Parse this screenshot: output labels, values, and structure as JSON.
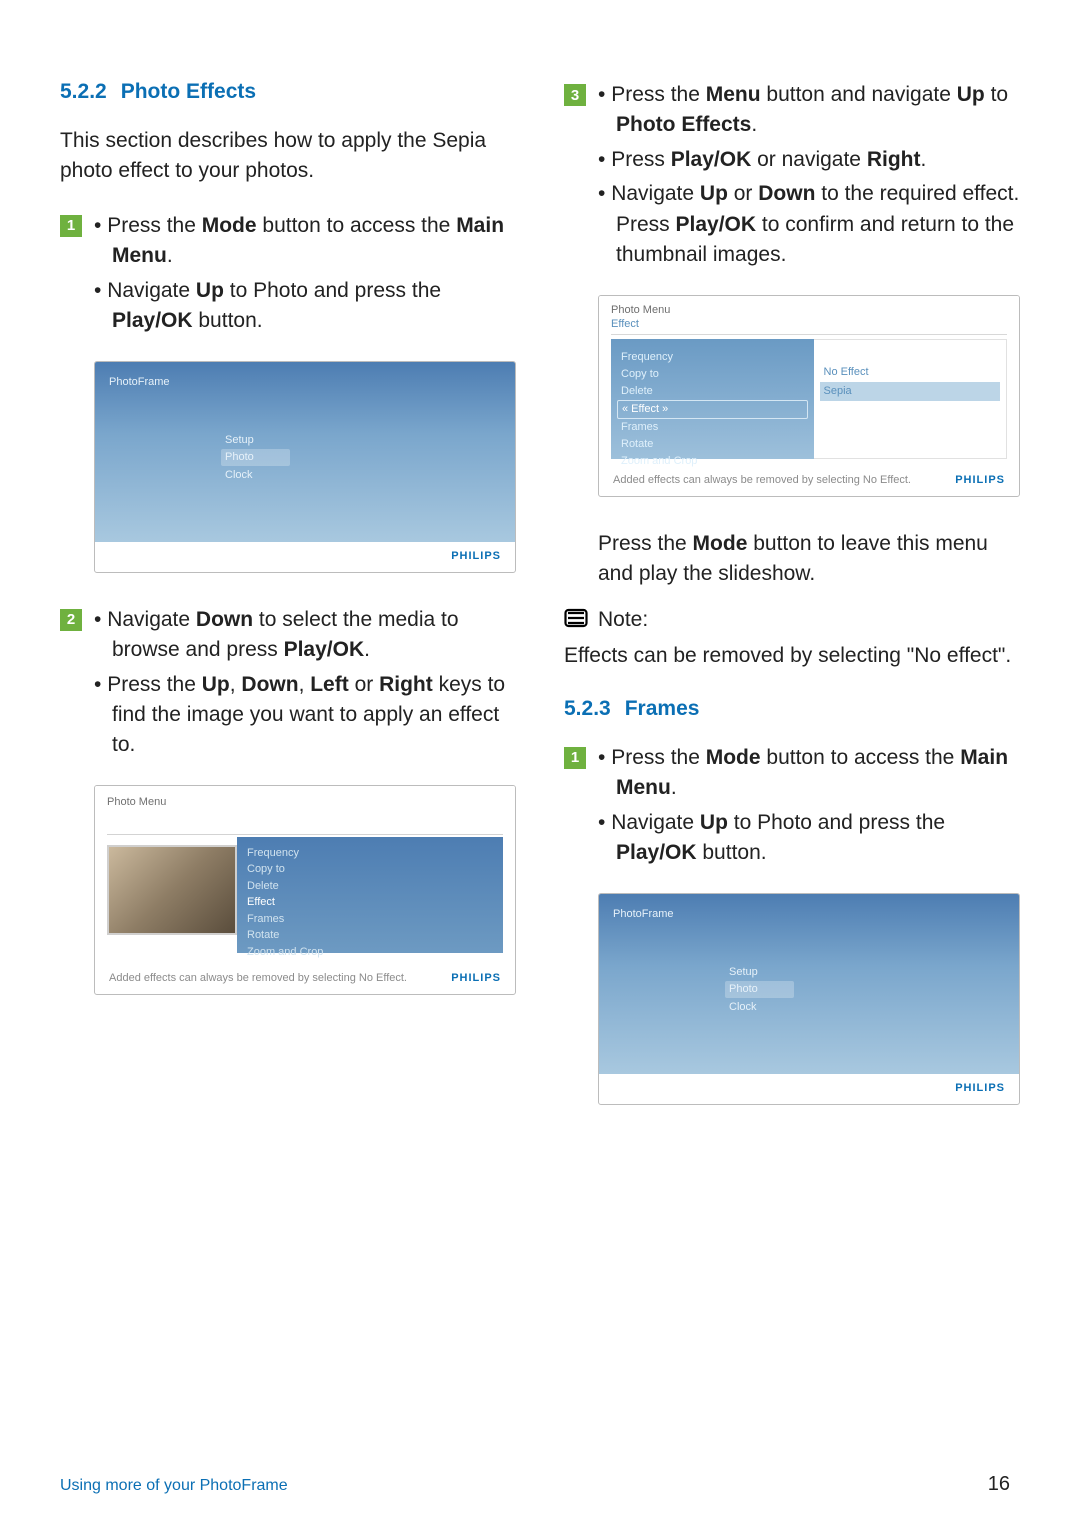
{
  "sections": {
    "s522": {
      "num": "5.2.2",
      "title": "Photo Effects"
    },
    "s523": {
      "num": "5.2.3",
      "title": "Frames"
    }
  },
  "intro_522": "This section describes how to apply the Sepia photo effect to your photos.",
  "steps_left": {
    "s1a_pre": "Press the ",
    "s1a_b1": "Mode",
    "s1a_mid": " button to access the ",
    "s1a_b2": "Main Menu",
    "s1a_post": ".",
    "s1b_pre": "Navigate ",
    "s1b_b1": "Up",
    "s1b_mid": " to Photo and press the ",
    "s1b_b2": "Play/OK",
    "s1b_post": " button.",
    "s2a_pre": "Navigate ",
    "s2a_b1": "Down",
    "s2a_mid": " to select the media to browse and press ",
    "s2a_b2": "Play/OK",
    "s2a_post": ".",
    "s2b_pre": "Press the ",
    "s2b_b1": "Up",
    "s2b_c1": ", ",
    "s2b_b2": "Down",
    "s2b_c2": ", ",
    "s2b_b3": "Left",
    "s2b_c3": " or ",
    "s2b_b4": "Right",
    "s2b_post": " keys to find the image you want to apply an effect to."
  },
  "steps_right": {
    "s3a_pre": "Press the ",
    "s3a_b1": "Menu",
    "s3a_mid": " button and navigate ",
    "s3a_b2": "Up",
    "s3a_mid2": " to ",
    "s3a_b3": "Photo Effects",
    "s3a_post": ".",
    "s3b_pre": "Press ",
    "s3b_b1": "Play/OK",
    "s3b_mid": " or navigate ",
    "s3b_b2": "Right",
    "s3b_post": ".",
    "s3c_pre": "Navigate ",
    "s3c_b1": "Up",
    "s3c_mid": " or ",
    "s3c_b2": "Down",
    "s3c_mid2": " to the required effect. Press ",
    "s3c_b3": "Play/OK",
    "s3c_post": " to confirm and return to the thumbnail images."
  },
  "after_screen3_pre": "Press the ",
  "after_screen3_b": "Mode",
  "after_screen3_post": " button to leave this menu and play the slideshow.",
  "note": {
    "label": "Note:",
    "text": "Effects can be removed by selecting \"No effect\"."
  },
  "frames_step1": {
    "a_pre": "Press the ",
    "a_b1": "Mode",
    "a_mid": " button to access the ",
    "a_b2": "Main Menu",
    "a_post": ".",
    "b_pre": "Navigate ",
    "b_b1": "Up",
    "b_mid": " to Photo and press the ",
    "b_b2": "Play/OK",
    "b_post": " button."
  },
  "screen_main": {
    "title": "PhotoFrame",
    "items": [
      "Setup",
      "Photo",
      "Clock"
    ],
    "brand": "PHILIPS"
  },
  "screen_pm": {
    "h1": "Photo Menu",
    "list": [
      "Frequency",
      "Copy to",
      "Delete",
      "Effect",
      "Frames",
      "Rotate",
      "Zoom and Crop"
    ],
    "footnote": "Added effects can always be removed by selecting No Effect.",
    "brand": "PHILIPS"
  },
  "screen_eff": {
    "h1": "Photo Menu",
    "h2": "Effect",
    "left": [
      "Frequency",
      "Copy to",
      "Delete",
      "« Effect »",
      "Frames",
      "Rotate",
      "Zoom and Crop"
    ],
    "right": [
      "No Effect",
      "Sepia"
    ],
    "footnote": "Added effects can always be removed by selecting No Effect.",
    "brand": "PHILIPS"
  },
  "footer": {
    "left": "Using more of your PhotoFrame",
    "page": "16"
  }
}
